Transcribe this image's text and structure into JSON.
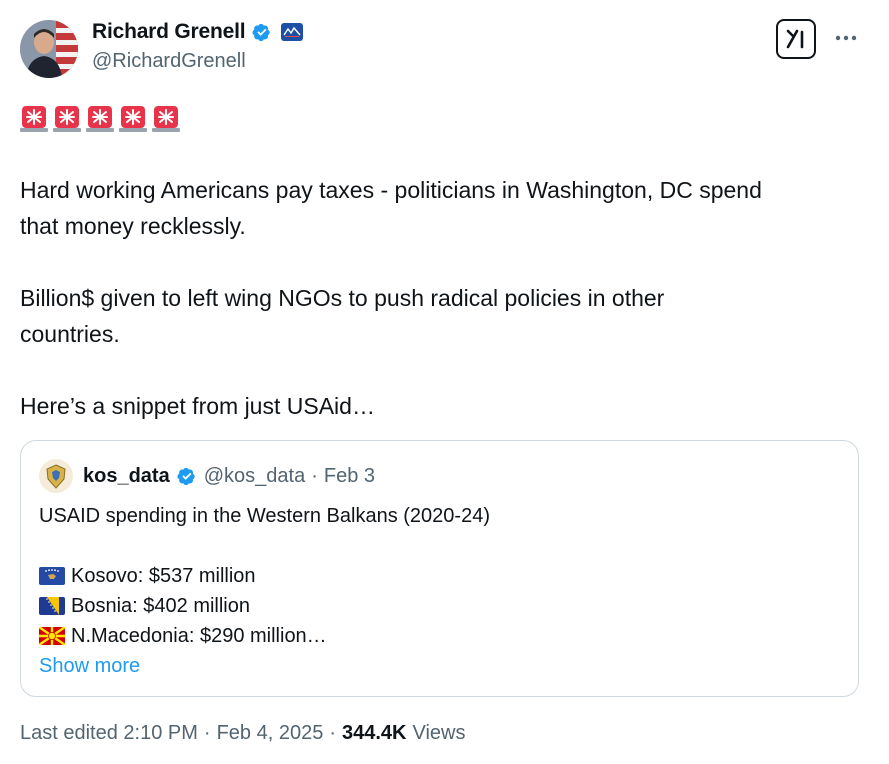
{
  "author": {
    "display_name": "Richard Grenell",
    "handle": "@RichardGrenell",
    "verified": true,
    "affiliation_badge": "affiliation-badge-icon"
  },
  "header_actions": {
    "grok_icon": "grok-icon",
    "more_label": "···"
  },
  "emoji_row": [
    "police-siren-icon",
    "police-siren-icon",
    "police-siren-icon",
    "police-siren-icon",
    "police-siren-icon"
  ],
  "tweet": {
    "paragraph_1_line_1": "Hard working Americans pay taxes - politicians in Washington, DC spend",
    "paragraph_1_line_2": "that money recklessly.",
    "paragraph_2_line_1": "Billion$ given to left wing NGOs to push radical policies in other",
    "paragraph_2_line_2": "countries.",
    "paragraph_3": "Here’s a snippet from just USAid…"
  },
  "quoted_tweet": {
    "display_name": "kos_data",
    "handle": "@kos_data",
    "separator": "·",
    "date": "Feb 3",
    "text": "USAID spending in the Western Balkans (2020-24)",
    "items": [
      {
        "flag": "kosovo-flag-icon",
        "text": "Kosovo: $537 million"
      },
      {
        "flag": "bosnia-flag-icon",
        "text": "Bosnia: $402 million"
      },
      {
        "flag": "north-macedonia-flag-icon",
        "text": "N.Macedonia: $290 million…"
      }
    ],
    "show_more": "Show more"
  },
  "footer": {
    "edited": "Last edited 2:10 PM",
    "sep1": "·",
    "date": "Feb 4, 2025",
    "sep2": "·",
    "views_count": "344.4K",
    "views_label": "Views"
  },
  "colors": {
    "text": "#0f1419",
    "secondary": "#536471",
    "link": "#1d9bf0",
    "verified": "#1d9bf0",
    "border": "#cfd9de",
    "siren_red": "#e8344b"
  }
}
